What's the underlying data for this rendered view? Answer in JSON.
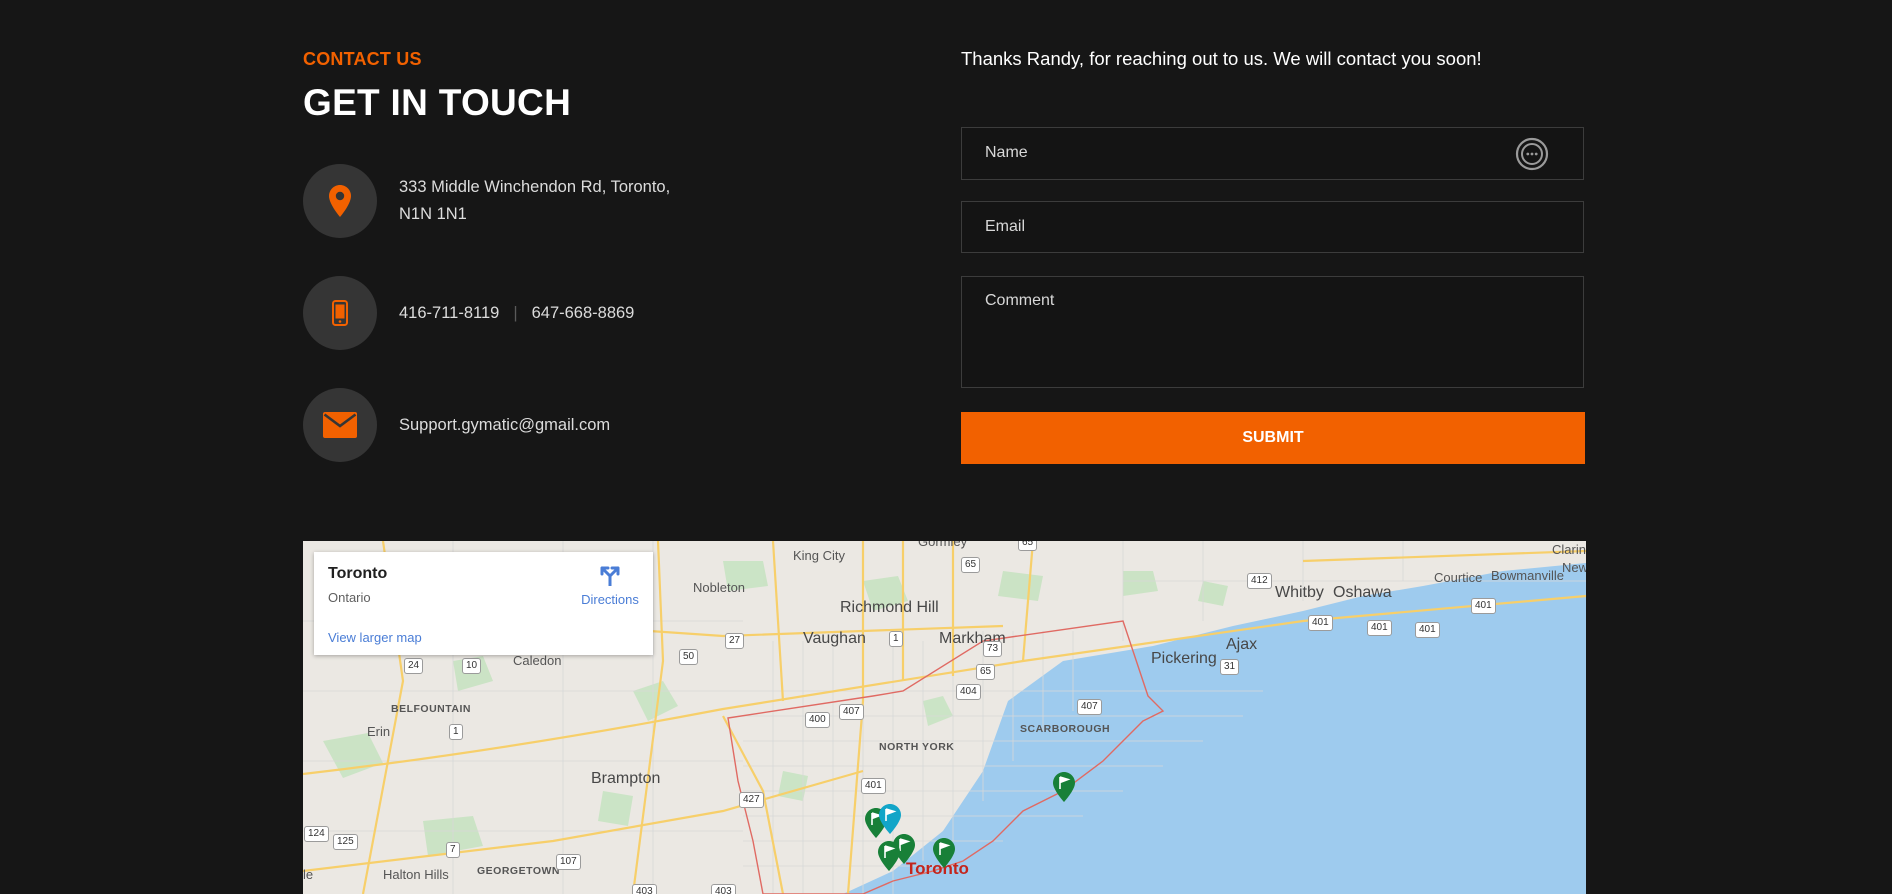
{
  "contact": {
    "eyebrow": "CONTACT US",
    "title": "GET IN TOUCH",
    "address_line1": "333 Middle Winchendon Rd, Toronto,",
    "address_line2": "N1N 1N1",
    "phone1": "416-711-8119",
    "phone_separator": "|",
    "phone2": "647-668-8869",
    "email": "Support.gymatic@gmail.com",
    "icons": [
      "location-pin-icon",
      "mobile-phone-icon",
      "envelope-icon"
    ],
    "accent_color": "#f26100"
  },
  "form": {
    "thanks_message": "Thanks Randy, for reaching out to us. We will contact you soon!",
    "name_placeholder": "Name",
    "email_placeholder": "Email",
    "comment_placeholder": "Comment",
    "submit_label": "SUBMIT"
  },
  "map": {
    "card_title": "Toronto",
    "card_subtitle": "Ontario",
    "directions_label": "Directions",
    "larger_map_label": "View larger map",
    "places": {
      "king_city": "King City",
      "gormley": "Gormley",
      "nobleton": "Nobleton",
      "richmond_hill": "Richmond Hill",
      "vaughan": "Vaughan",
      "markham": "Markham",
      "caledon": "Caledon",
      "belfountain": "BELFOUNTAIN",
      "erin": "Erin",
      "brampton": "Brampton",
      "north_york": "NORTH YORK",
      "scarborough": "SCARBOROUGH",
      "pickering": "Pickering",
      "ajax": "Ajax",
      "whitby": "Whitby",
      "oshawa": "Oshawa",
      "courtice": "Courtice",
      "bowmanville": "Bowmanville",
      "clarington": "Clarin",
      "newcastle": "New",
      "halton_hills": "Halton Hills",
      "georgetown": "GEORGETOWN",
      "toronto": "Toronto",
      "edge": "le"
    },
    "highways": [
      "65",
      "65",
      "412",
      "401",
      "401",
      "27",
      "50",
      "73",
      "65",
      "404",
      "24",
      "10",
      "407",
      "400",
      "407",
      "401",
      "1",
      "1",
      "124",
      "125",
      "7",
      "107",
      "427",
      "401",
      "31",
      "401",
      "403",
      "403"
    ]
  }
}
